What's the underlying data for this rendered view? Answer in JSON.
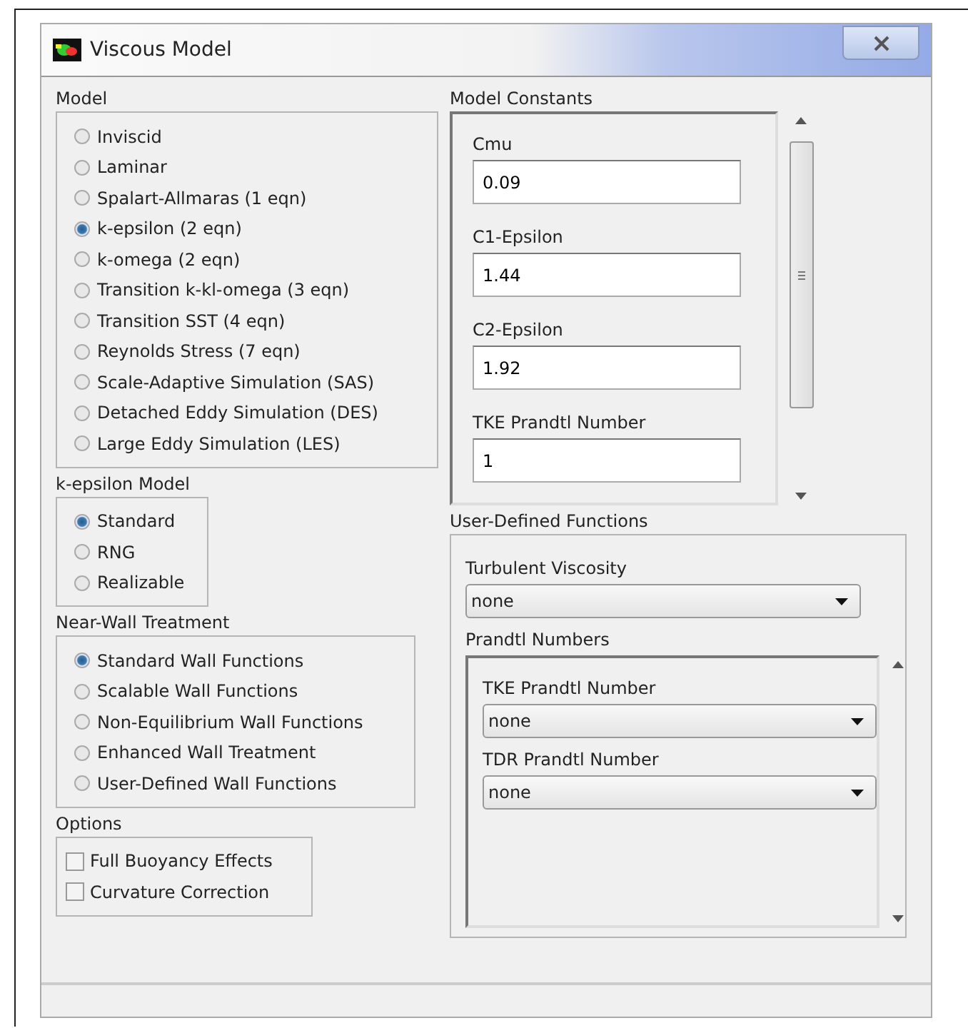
{
  "window": {
    "title": "Viscous Model"
  },
  "model": {
    "title": "Model",
    "options": [
      {
        "label": "Inviscid",
        "selected": false
      },
      {
        "label": "Laminar",
        "selected": false
      },
      {
        "label": "Spalart-Allmaras (1 eqn)",
        "selected": false
      },
      {
        "label": "k-epsilon (2 eqn)",
        "selected": true
      },
      {
        "label": "k-omega (2 eqn)",
        "selected": false
      },
      {
        "label": "Transition k-kl-omega (3 eqn)",
        "selected": false
      },
      {
        "label": "Transition SST (4 eqn)",
        "selected": false
      },
      {
        "label": "Reynolds Stress (7 eqn)",
        "selected": false
      },
      {
        "label": "Scale-Adaptive Simulation (SAS)",
        "selected": false
      },
      {
        "label": "Detached Eddy Simulation (DES)",
        "selected": false
      },
      {
        "label": "Large Eddy Simulation (LES)",
        "selected": false
      }
    ]
  },
  "k_epsilon_model": {
    "title": "k-epsilon Model",
    "options": [
      {
        "label": "Standard",
        "selected": true
      },
      {
        "label": "RNG",
        "selected": false
      },
      {
        "label": "Realizable",
        "selected": false
      }
    ]
  },
  "near_wall_treatment": {
    "title": "Near-Wall Treatment",
    "options": [
      {
        "label": "Standard Wall Functions",
        "selected": true
      },
      {
        "label": "Scalable Wall Functions",
        "selected": false
      },
      {
        "label": "Non-Equilibrium Wall Functions",
        "selected": false
      },
      {
        "label": "Enhanced Wall Treatment",
        "selected": false
      },
      {
        "label": "User-Defined Wall Functions",
        "selected": false
      }
    ]
  },
  "options": {
    "title": "Options",
    "items": [
      {
        "label": "Full Buoyancy Effects",
        "checked": false
      },
      {
        "label": "Curvature Correction",
        "checked": false
      }
    ]
  },
  "model_constants": {
    "title": "Model Constants",
    "fields": [
      {
        "label": "Cmu",
        "value": "0.09"
      },
      {
        "label": "C1-Epsilon",
        "value": "1.44"
      },
      {
        "label": "C2-Epsilon",
        "value": "1.92"
      },
      {
        "label": "TKE Prandtl Number",
        "value": "1"
      }
    ]
  },
  "user_defined_functions": {
    "title": "User-Defined Functions",
    "turbulent_viscosity": {
      "label": "Turbulent Viscosity",
      "value": "none"
    },
    "prandtl_numbers": {
      "title": "Prandtl Numbers",
      "dropdowns": [
        {
          "label": "TKE Prandtl Number",
          "value": "none"
        },
        {
          "label": "TDR Prandtl Number",
          "value": "none"
        }
      ]
    }
  }
}
